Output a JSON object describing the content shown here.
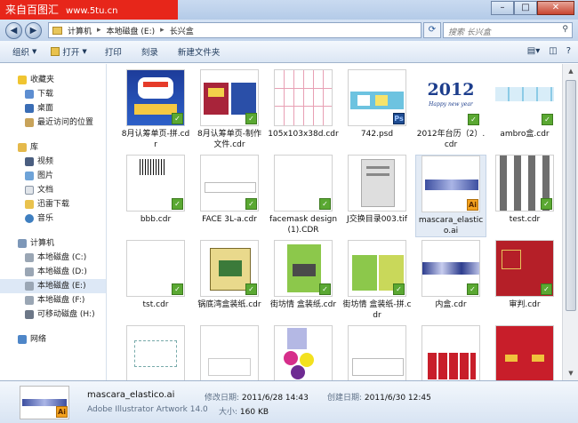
{
  "watermark": {
    "text": "来自百图汇",
    "site": "www.5tu.cn"
  },
  "window": {
    "min": "–",
    "max": "□",
    "close": "✕"
  },
  "address": {
    "parts": [
      "计算机",
      "本地磁盘 (E:)",
      "长兴盒"
    ],
    "search_placeholder": "搜索 长兴盒"
  },
  "toolbar": {
    "organize": "组织",
    "open": "打开",
    "print": "打印",
    "burn": "刻录",
    "new_folder": "新建文件夹"
  },
  "nav": {
    "favorites": {
      "label": "收藏夹",
      "items": [
        "下载",
        "桌面",
        "最近访问的位置"
      ]
    },
    "library": {
      "label": "库",
      "items": [
        "视频",
        "图片",
        "文档",
        "迅雷下载",
        "音乐"
      ]
    },
    "computer": {
      "label": "计算机",
      "items": [
        "本地磁盘 (C:)",
        "本地磁盘 (D:)",
        "本地磁盘 (E:)",
        "本地磁盘 (F:)",
        "可移动磁盘 (H:)"
      ]
    },
    "network": {
      "label": "网络"
    }
  },
  "files": [
    {
      "name": "8月认筹单页-拼.cdr",
      "badge": "cdr"
    },
    {
      "name": "8月认筹单页-制作文件.cdr",
      "badge": "cdr"
    },
    {
      "name": "105x103x38d.cdr",
      "badge": "cdr"
    },
    {
      "name": "742.psd",
      "badge": "ps"
    },
    {
      "name": "2012年台历（2）.cdr",
      "badge": "cdr"
    },
    {
      "name": "ambro盒.cdr",
      "badge": "cdr"
    },
    {
      "name": "bbb.cdr",
      "badge": "cdr"
    },
    {
      "name": "FACE 3L-a.cdr",
      "badge": "cdr"
    },
    {
      "name": "facemask design(1).CDR",
      "badge": "cdr"
    },
    {
      "name": "J交换目录003.tif",
      "badge": "none"
    },
    {
      "name": "mascara_elastico.ai",
      "badge": "ai"
    },
    {
      "name": "test.cdr",
      "badge": "cdr"
    },
    {
      "name": "tst.cdr",
      "badge": "cdr"
    },
    {
      "name": "锅底湾盒装纸.cdr",
      "badge": "cdr"
    },
    {
      "name": "街坊情 盒装纸.cdr",
      "badge": "cdr"
    },
    {
      "name": "街坊情 盒装纸-拼.cdr",
      "badge": "cdr"
    },
    {
      "name": "内盒.cdr",
      "badge": "cdr"
    },
    {
      "name": "审判.cdr",
      "badge": "cdr"
    },
    {
      "name": "",
      "badge": "none"
    },
    {
      "name": "",
      "badge": "none"
    },
    {
      "name": "",
      "badge": "none"
    },
    {
      "name": "",
      "badge": "none"
    },
    {
      "name": "",
      "badge": "none"
    },
    {
      "name": "",
      "badge": "none"
    }
  ],
  "thumb_text": {
    "calendar_year": "2012",
    "calendar_sub": "Happy new year",
    "ai_badge": "Ai",
    "ps_badge": "Ps",
    "cdr_badge": "✓"
  },
  "details": {
    "name": "mascara_elastico.ai",
    "type": "Adobe Illustrator Artwork 14.0",
    "modified_label": "修改日期:",
    "modified": "2011/6/28 14:43",
    "created_label": "创建日期:",
    "created": "2011/6/30 12:45",
    "size_label": "大小:",
    "size": "160 KB"
  }
}
